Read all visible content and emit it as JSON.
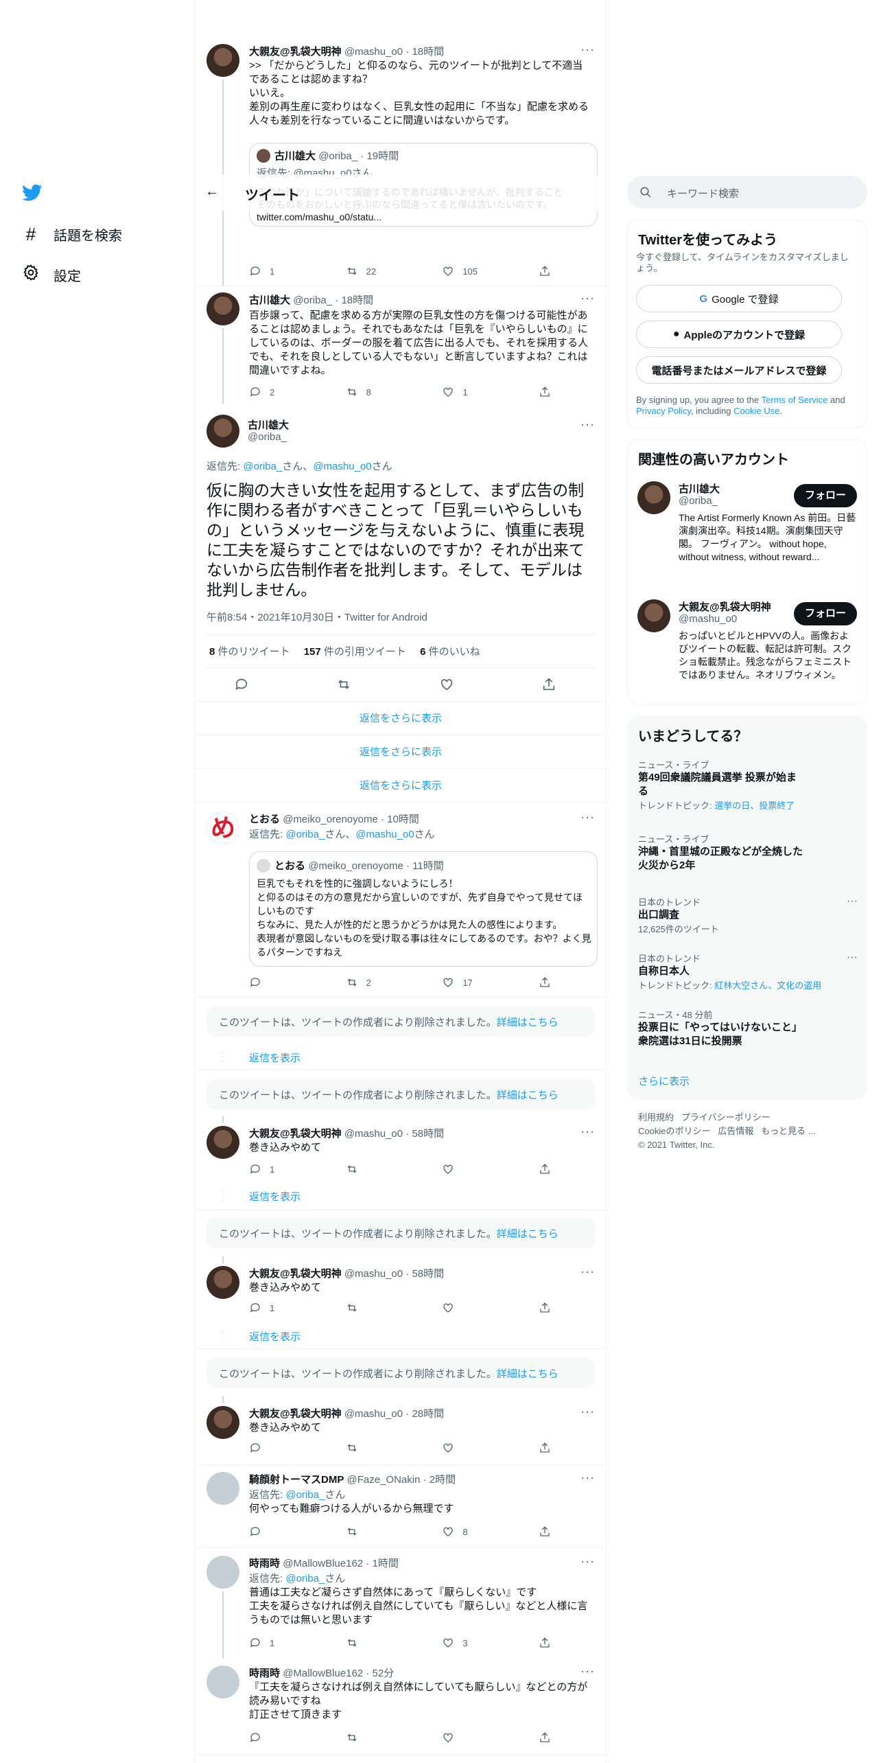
{
  "nav": {
    "explore": "話題を検索",
    "settings": "設定"
  },
  "header": {
    "title": "ツイート"
  },
  "t1": {
    "name": "大親友@乳袋大明神",
    "handle": "@mashu_o0",
    "time": "18時間",
    "text": ">> 「だからどうした」と仰るのなら、元のツイートが批判として不適当であることは認めますね？\nいいえ。\n差別の再生産に変わりはなく、巨乳女性の起用に「不当な」配慮を求める人々も差別を行なっていることに間違いはないからです。",
    "quote_name": "古川雄大",
    "quote_handle": "@oriba_",
    "quote_time": "19時間",
    "quote_reply_prefix": "返信先: ",
    "quote_reply_handle": "@mashu_o0",
    "quote_reply_suffix": "さん",
    "quote_text": "るのか否か」について議論するのであれば構いませんが、批判すること\nそのものをおかしいと呼ぶのなら間違ってると僕は言いたいのです。\ntwitter.com/mashu_o0/statu...",
    "replies": "1",
    "retweets": "22",
    "likes": "105"
  },
  "t2": {
    "name": "古川雄大",
    "handle": "@oriba_",
    "time": "18時間",
    "text": "百歩譲って、配慮を求める方が実際の巨乳女性の方を傷つける可能性があることは認めましょう。それでもあなたは「巨乳を『いやらしいもの』にしているのは、ボーダーの服を着て広告に出る人でも、それを採用する人でも、それを良しとしている人でもない」と断言していますよね？これは間違いですよね。",
    "replies": "2",
    "retweets": "8",
    "likes": "1"
  },
  "main": {
    "name": "古川雄大",
    "handle": "@oriba_",
    "reply_prefix": "返信先: ",
    "reply_h1": "@oriba_",
    "reply_mid": "さん、",
    "reply_h2": "@mashu_o0",
    "reply_suffix": "さん",
    "text": "仮に胸の大きい女性を起用するとして、まず広告の制作に関わる者がすべきことって「巨乳＝いやらしいもの」というメッセージを与えないように、慎重に表現に工夫を凝らすことではないのですか？それが出来てないから広告制作者を批判します。そして、モデルは批判しません。",
    "timestamp": "午前8:54・2021年10月30日・Twitter for Android",
    "rt_count": "8",
    "rt_label": " 件のリツイート",
    "qt_count": "157",
    "qt_label": " 件の引用ツイート",
    "like_count": "6",
    "like_label": " 件のいいね"
  },
  "more_replies": "返信をさらに表示",
  "t3": {
    "name": "とおる",
    "handle": "@meiko_orenoyome",
    "time": "10時間",
    "reply_prefix": "返信先: ",
    "reply_h1": "@oriba_",
    "reply_mid": "さん、",
    "reply_h2": "@mashu_o0",
    "reply_suffix": "さん",
    "quote_name": "とおる",
    "quote_handle": "@meiko_orenoyome",
    "quote_time": "11時間",
    "quote_text": "巨乳でもそれを性的に強調しないようにしろ！\nと仰るのはその方の意見だから宜しいのですが、先ず自身でやって見せてほしいものです\nちなみに、見た人が性的だと思うかどうかは見た人の感性によります。\n表現者が意図しないものを受け取る事は往々にしてあるのです。おや？よく見るパターンですねえ",
    "replies": "",
    "retweets": "2",
    "likes": "17"
  },
  "deleted": {
    "text": "このツイートは、ツイートの作成者により削除されました。",
    "link": "詳細はこちら"
  },
  "show_replies": "返信を表示",
  "t4": {
    "name": "大親友@乳袋大明神",
    "handle": "@mashu_o0",
    "time": "58時間",
    "text": "巻き込みやめて",
    "replies": "1"
  },
  "t5": {
    "name": "大親友@乳袋大明神",
    "handle": "@mashu_o0",
    "time": "58時間",
    "text": "巻き込みやめて",
    "replies": "1"
  },
  "t6": {
    "name": "大親友@乳袋大明神",
    "handle": "@mashu_o0",
    "time": "28時間",
    "text": "巻き込みやめて"
  },
  "t7": {
    "name": "騎顔射トーマスDMP",
    "handle": "@Faze_ONakin",
    "time": "2時間",
    "reply_prefix": "返信先: ",
    "reply_h1": "@oriba_",
    "reply_suffix": "さん",
    "text": "何やっても難癖つける人がいるから無理です",
    "likes": "8"
  },
  "t8": {
    "name": "時雨時",
    "handle": "@MallowBlue162",
    "time": "1時間",
    "reply_prefix": "返信先: ",
    "reply_h1": "@oriba_",
    "reply_suffix": "さん",
    "text": "普通は工夫など凝らさず自然体にあって『厭らしくない』です\n工夫を凝らさなければ例え自然にしていても『厭らしい』などと人様に言うものでは無いと思います",
    "replies": "1",
    "likes": "3"
  },
  "t9": {
    "name": "時雨時",
    "handle": "@MallowBlue162",
    "time": "52分",
    "text": "『工夫を凝らさなければ例え自然体にしていても厭らしい』などとの方が読み易いですね\n訂正させて頂きます"
  },
  "search": {
    "placeholder": "キーワード検索"
  },
  "signup": {
    "title": "Twitterを使ってみよう",
    "subtitle": "今すぐ登録して、タイムラインをカスタマイズしましょう。",
    "google": "Google で登録",
    "apple": "Appleのアカウントで登録",
    "phone": "電話番号またはメールアドレスで登録",
    "legal_a": "By signing up, you agree to the ",
    "legal_tos": "Terms of Service",
    "legal_b": " and ",
    "legal_pp": "Privacy Policy",
    "legal_c": ", including ",
    "legal_cookie": "Cookie Use",
    "legal_d": "."
  },
  "related": {
    "title": "関連性の高いアカウント",
    "follow": "フォロー",
    "a1": {
      "name": "古川雄大",
      "handle": "@oriba_",
      "bio": "The Artist Formerly Known As 前田。日藝演劇演出卒。科技14期。演劇集団天守閣。 フーヴィアン。 without hope, without witness, without reward..."
    },
    "a2": {
      "name": "大親友@乳袋大明神",
      "handle": "@mashu_o0",
      "bio": "おっぱいとビルとHPVVの人。画像およびツイートの転載、転記は許可制。スクショ転載禁止。残念ながらフェミニストではありません。ネオリブウィメン。"
    }
  },
  "trends": {
    "title": "いまどうしてる？",
    "items": [
      {
        "cat": "ニュース・ライブ",
        "name": "第49回衆議院議員選挙 投票が始まる",
        "sub_prefix": "トレンドトピック: ",
        "sub_link": "選挙の日、投票終了"
      },
      {
        "cat": "ニュース・ライブ",
        "name": "沖縄・首里城の正殿などが全焼した火災から2年"
      },
      {
        "cat": "日本のトレンド",
        "name": "出口調査",
        "sub": "12,625件のツイート"
      },
      {
        "cat": "日本のトレンド",
        "name": "自称日本人",
        "sub_prefix": "トレンドトピック: ",
        "sub_link": "紅林大空さん、文化の盗用"
      },
      {
        "cat": "ニュース・48 分前",
        "name": "投票日に「やってはいけないこと」衆院選は31日に投開票"
      }
    ],
    "more": "さらに表示"
  },
  "footer": {
    "l1": "利用規約",
    "l2": "プライバシーポリシー",
    "l3": "Cookieのポリシー",
    "l4": "広告情報",
    "l5": "もっと見る ...",
    "copy": "© 2021 Twitter, Inc."
  },
  "colors": {
    "accent": "#1d9bf0",
    "text": "#0f1419",
    "muted": "#536471"
  }
}
